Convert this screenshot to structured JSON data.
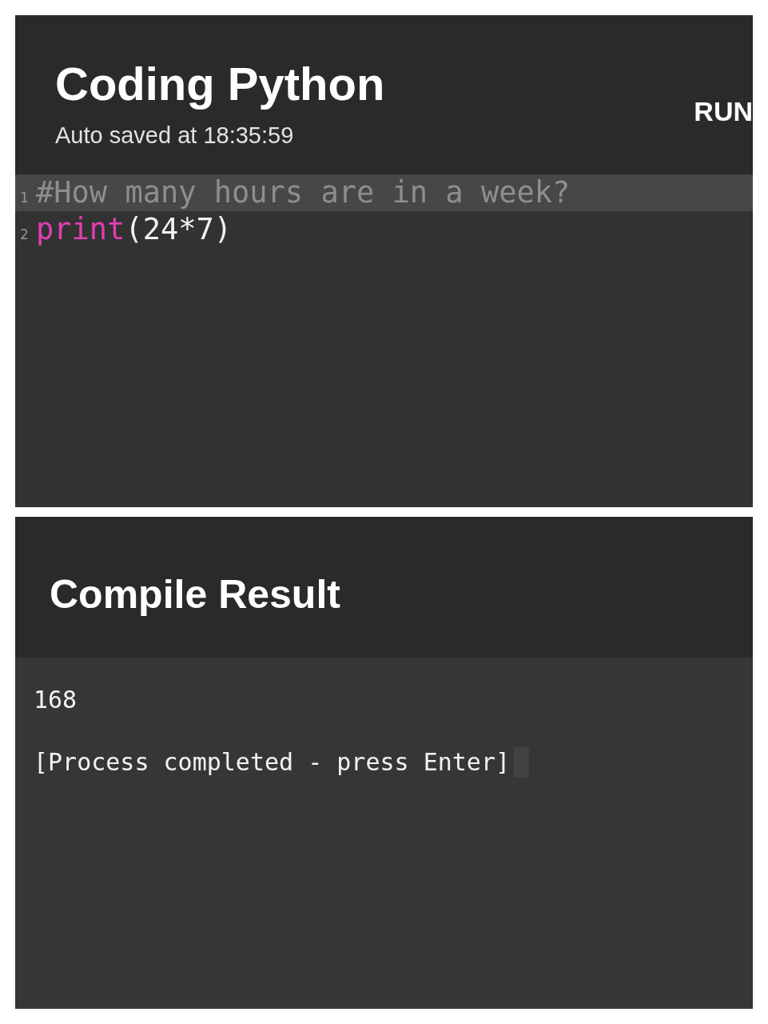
{
  "editor": {
    "title": "Coding Python",
    "subtitle": "Auto saved at 18:35:59",
    "run_button": "RUN",
    "lines": [
      {
        "number": "1",
        "selected": true,
        "tokens": [
          {
            "kind": "comment",
            "text": "#How many hours are in a week?"
          }
        ]
      },
      {
        "number": "2",
        "selected": false,
        "tokens": [
          {
            "kind": "keyword",
            "text": "print"
          },
          {
            "kind": "plain",
            "text": "(24*7)"
          }
        ]
      }
    ]
  },
  "result": {
    "title": "Compile Result",
    "output": [
      "168",
      "[Process completed - press Enter]"
    ],
    "cursor": true
  }
}
